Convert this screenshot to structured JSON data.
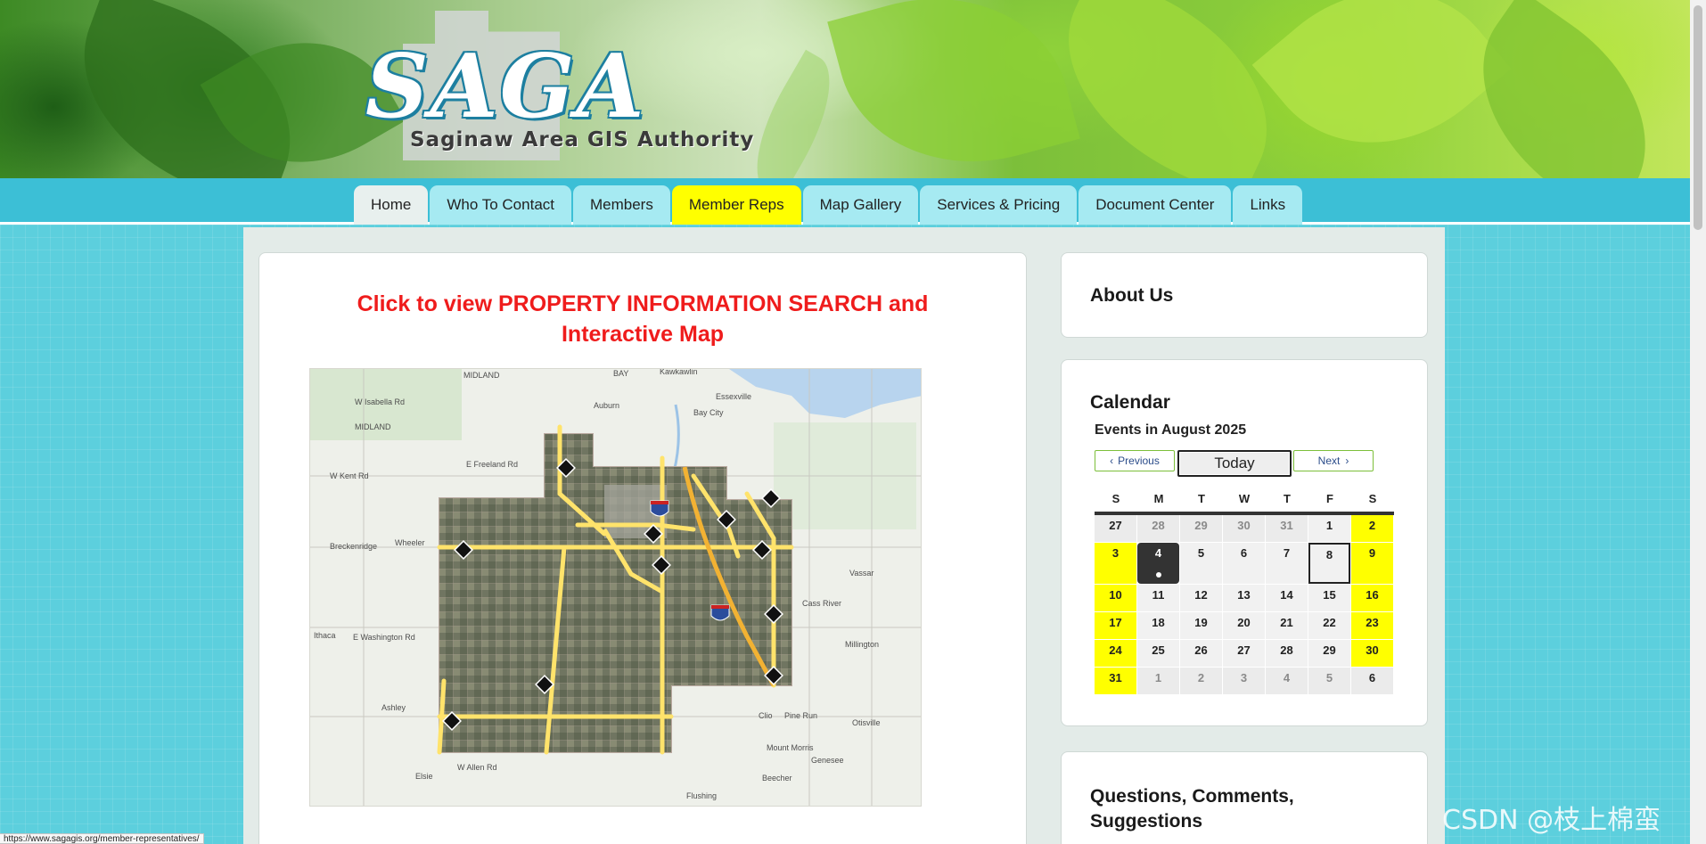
{
  "logo": {
    "title": "SAGA",
    "subtitle": "Saginaw Area GIS Authority"
  },
  "nav": {
    "items": [
      {
        "label": "Home",
        "state": "active"
      },
      {
        "label": "Who To Contact",
        "state": ""
      },
      {
        "label": "Members",
        "state": ""
      },
      {
        "label": "Member Reps",
        "state": "highlight"
      },
      {
        "label": "Map Gallery",
        "state": ""
      },
      {
        "label": "Services & Pricing",
        "state": ""
      },
      {
        "label": "Document Center",
        "state": ""
      },
      {
        "label": "Links",
        "state": ""
      }
    ]
  },
  "main": {
    "link_text": "Click to view PROPERTY INFORMATION SEARCH and Interactive Map",
    "map_labels": {
      "midland_top": "MIDLAND",
      "bay": "BAY",
      "kawkawlin": "Kawkawlin",
      "essexville": "Essexville",
      "auburn": "Auburn",
      "bay_city": "Bay City",
      "midland": "MIDLAND",
      "w_isabella": "W Isabella Rd",
      "e_freeland": "E Freeland Rd",
      "w_kent": "W Kent Rd",
      "breckenridge": "Breckenridge",
      "wheeler": "Wheeler",
      "vassar": "Vassar",
      "ithaca": "Ithaca",
      "e_washington": "E Washington Rd",
      "millington": "Millington",
      "ashley": "Ashley",
      "clio": "Clio",
      "pine_run": "Pine Run",
      "otisville": "Otisville",
      "mount_morris": "Mount Morris",
      "genesee": "Genesee",
      "elsie": "Elsie",
      "w_allen": "W Allen Rd",
      "flushing": "Flushing",
      "beecher": "Beecher",
      "cass_river": "Cass River"
    }
  },
  "sidebar": {
    "about_title": "About Us",
    "calendar_title": "Calendar",
    "calendar_month": "Events in August 2025",
    "prev_label": "Previous",
    "today_label": "Today",
    "next_label": "Next",
    "weekdays": [
      "S",
      "M",
      "T",
      "W",
      "T",
      "F",
      "S"
    ],
    "weeks": [
      [
        "27",
        "28",
        "29",
        "30",
        "31",
        "1",
        "2"
      ],
      [
        "3",
        "4",
        "5",
        "6",
        "7",
        "8",
        "9"
      ],
      [
        "10",
        "11",
        "12",
        "13",
        "14",
        "15",
        "16"
      ],
      [
        "17",
        "18",
        "19",
        "20",
        "21",
        "22",
        "23"
      ],
      [
        "24",
        "25",
        "26",
        "27",
        "28",
        "29",
        "30"
      ],
      [
        "31",
        "1",
        "2",
        "3",
        "4",
        "5",
        "6"
      ]
    ],
    "today_day": "4",
    "selected_day": "8",
    "questions_title": "Questions, Comments, Suggestions"
  },
  "status_url": "https://www.sagagis.org/member-representatives/",
  "watermark": "CSDN @枝上棉蛮",
  "colors": {
    "nav_bar": "#3cbfd6",
    "nav_tab": "#a6eaf2",
    "highlight": "#ffff00",
    "link_red": "#ef1c1c",
    "page_bg": "#5ccfdd"
  }
}
